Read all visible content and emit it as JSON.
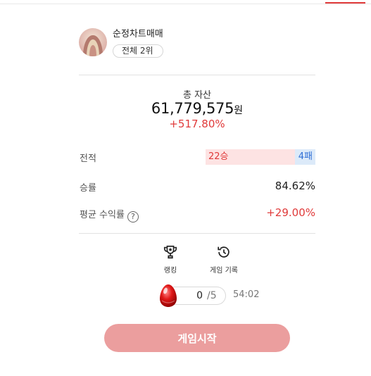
{
  "profile": {
    "username": "순정차트매매",
    "rank": "전체 2위"
  },
  "assets": {
    "label": "총 자산",
    "value": "61,779,575",
    "unit": "원",
    "return": "+517.80%"
  },
  "stats": {
    "record_label": "전적",
    "wins": "22승",
    "losses": "4패",
    "winrate_label": "승률",
    "winrate_value": "84.62%",
    "avg_return_label": "평균 수익률",
    "avg_return_value": "+29.00%",
    "help_glyph": "?"
  },
  "nav": {
    "ranking_label": "랭킹",
    "history_label": "게임 기록"
  },
  "game": {
    "current": "0",
    "max": "/5",
    "timer": "54:02",
    "start_label": "게임시작"
  },
  "colors": {
    "accent_red": "#e03a3a",
    "loss_blue": "#2f6fd6",
    "start_button": "#eb9e9e"
  },
  "icons": [
    "trophy-icon",
    "history-icon",
    "egg-icon",
    "help-icon"
  ]
}
